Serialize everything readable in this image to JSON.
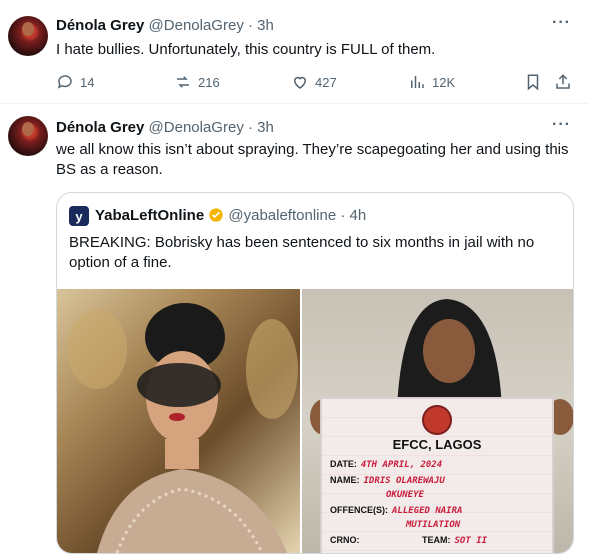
{
  "tweet1": {
    "name": "Dénola Grey",
    "handle": "@DenolaGrey",
    "time": "· 3h",
    "text": "I hate bullies. Unfortunately, this country is FULL of them.",
    "replies": "14",
    "retweets": "216",
    "likes": "427",
    "views": "12K"
  },
  "tweet2": {
    "name": "Dénola Grey",
    "handle": "@DenolaGrey",
    "time": "· 3h",
    "text": "we all know this isn’t about spraying. They’re scapegoating her and using this BS as a reason.",
    "quote": {
      "logo_letter": "y",
      "name": "YabaLeftOnline",
      "handle": "@yabaleftonline",
      "time": "· 4h",
      "text": "BREAKING: Bobrisky has been sentenced to six months in jail with no option of a fine.",
      "board": {
        "title": "EFCC, LAGOS",
        "date_label": "DATE:",
        "date_value": "4TH APRIL, 2024",
        "name_label": "NAME:",
        "name_value_1": "IDRIS OLAREWAJU",
        "name_value_2": "OKUNEYE",
        "offence_label": "OFFENCE(S):",
        "offence_value_1": "ALLEGED NAIRA",
        "offence_value_2": "MUTILATION",
        "crno_label": "CRNO:",
        "team_label": "TEAM:",
        "team_value": "SOT II"
      }
    }
  },
  "colors": {
    "text": "#0f1419",
    "muted": "#536471",
    "border": "#cfd9de",
    "verified": "#f4b400",
    "board_ink": "#c81e3c"
  }
}
